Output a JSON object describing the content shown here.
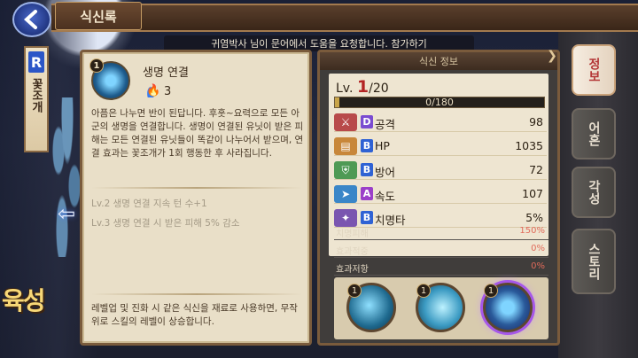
{
  "app": {
    "title": "식신록"
  },
  "notice": {
    "text": "귀염박사  님이 문어에서 도움을 요청합니다. 참가하기"
  },
  "side": {
    "grade": "R",
    "name": "꽃조개"
  },
  "growth_label": "육성",
  "skill": {
    "level": "1",
    "name": "생명 연결",
    "cost": "3",
    "description": "아픔은 나누면 반이 된답니다. 후훗~요력으로 모든 아군의 생명을 연결합니다. 생명이 연결된 유닛이 받은 피해는 모든 연결된 유닛들이 똑같이 나누어서 받으며, 연결 효과는 꽃조개가 1회 행동한 후 사라집니다.",
    "upgrades": [
      "Lv.2   생명 연결 지속 턴 수+1",
      "Lv.3   생명 연결 시 받은 피해 5% 감소"
    ],
    "footer": "레벨업 및 진화 시 같은 식신을 재료로 사용하면, 무작위로 스킬의 레벨이 상승합니다."
  },
  "stats": {
    "header": "식신 정보",
    "level_prefix": "Lv.",
    "level_current": "1",
    "level_max": "/20",
    "exp_text": "0/180",
    "exp_progress": 0.02,
    "rows": [
      {
        "icon": "sword-icon",
        "grade": "D",
        "grade_color": "#7a4bd1",
        "label": "공격",
        "value": "98",
        "icon_color": "#b84a4a"
      },
      {
        "icon": "scroll-icon",
        "grade": "B",
        "grade_color": "#2f62d4",
        "label": "HP",
        "value": "1035",
        "icon_color": "#c8873a"
      },
      {
        "icon": "shield-icon",
        "grade": "B",
        "grade_color": "#2f62d4",
        "label": "방어",
        "value": "72",
        "icon_color": "#4f9a54"
      },
      {
        "icon": "wing-icon",
        "grade": "A",
        "grade_color": "#9b3fc9",
        "label": "속도",
        "value": "107",
        "icon_color": "#3a86c8"
      },
      {
        "icon": "crit-icon",
        "grade": "B",
        "grade_color": "#2f62d4",
        "label": "치명타",
        "value": "5%",
        "icon_color": "#7a55b0"
      }
    ],
    "extras": [
      {
        "label": "치명피해",
        "value": "150%",
        "color": "#e06a5a"
      },
      {
        "label": "효과적중",
        "value": "0%",
        "color": "#e06a5a"
      },
      {
        "label": "효과저항",
        "value": "0%",
        "color": "#e06a5a"
      }
    ],
    "skill_slots": [
      {
        "level": "1",
        "name": "skill-slot-1"
      },
      {
        "level": "1",
        "name": "skill-slot-2"
      },
      {
        "level": "1",
        "name": "skill-slot-3"
      }
    ]
  },
  "tabs": [
    {
      "label": "정보",
      "active": true
    },
    {
      "label": "어혼",
      "active": false
    },
    {
      "label": "각성",
      "active": false
    },
    {
      "label": "스토리",
      "active": false
    }
  ]
}
